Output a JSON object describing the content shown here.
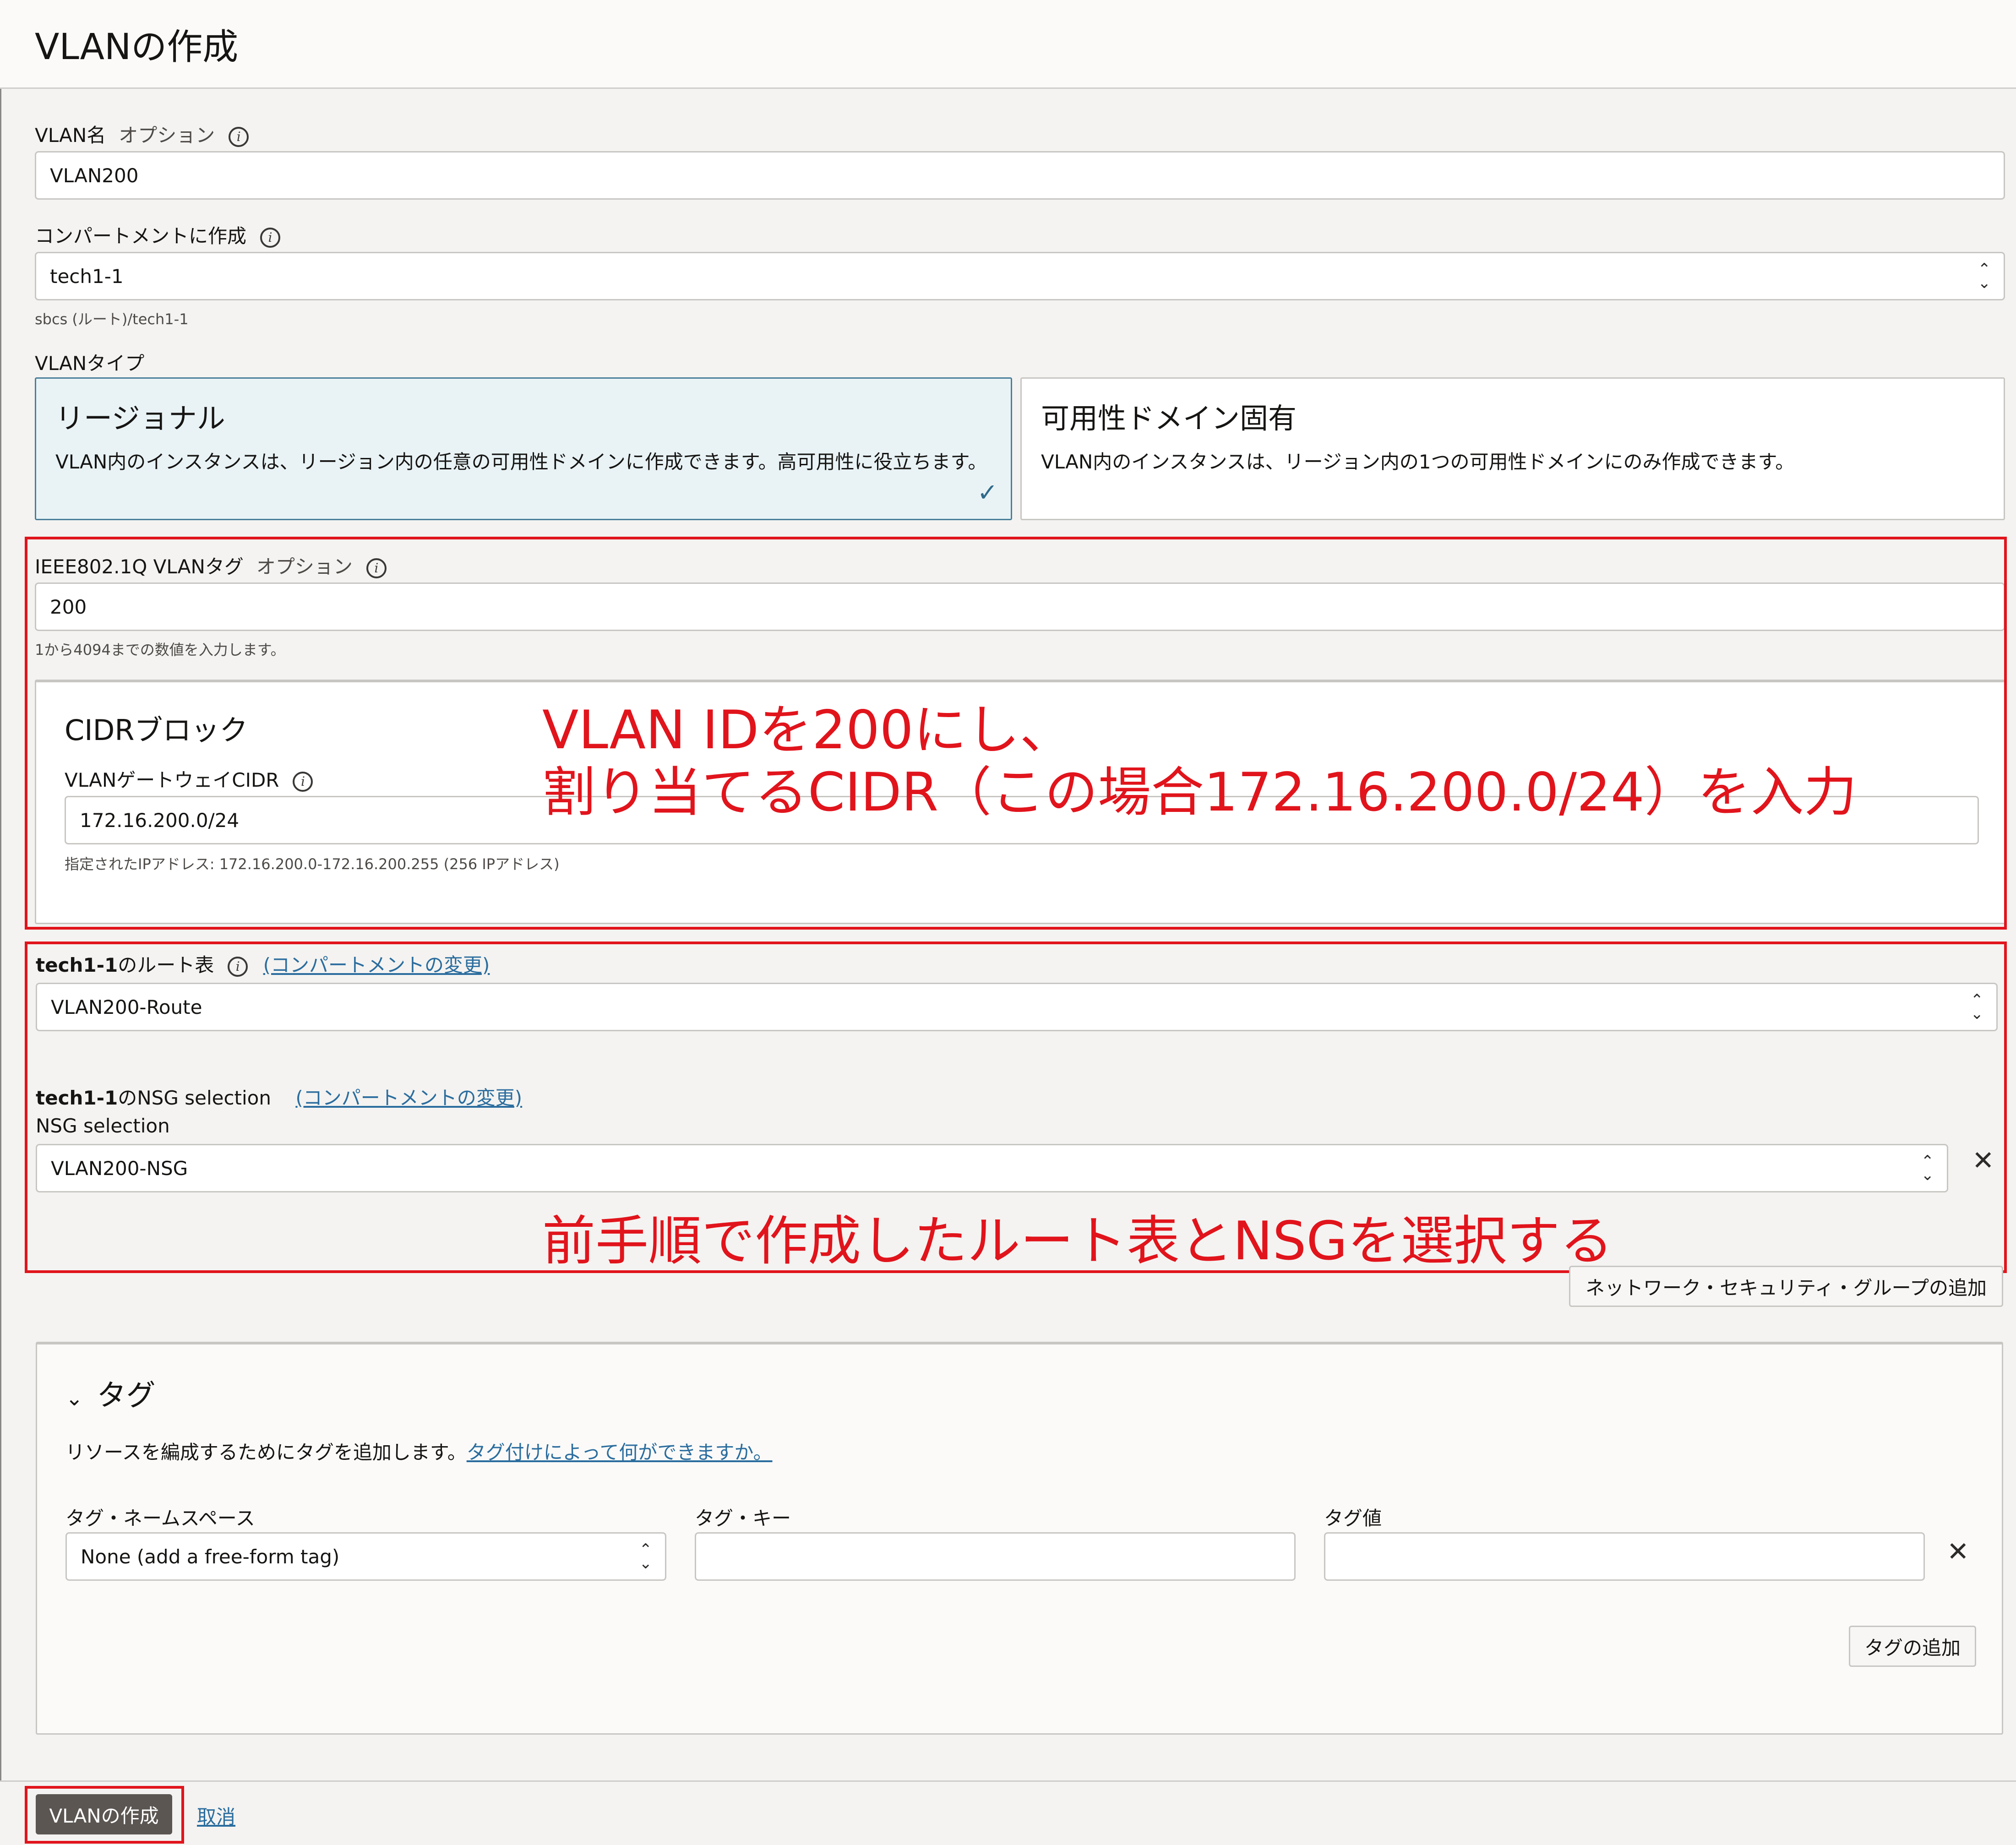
{
  "header": {
    "title": "VLANの作成"
  },
  "vlan_name": {
    "label": "VLAN名",
    "optional": "オプション",
    "value": "VLAN200"
  },
  "compartment": {
    "label": "コンパートメントに作成",
    "value": "tech1-1",
    "path": "sbcs (ルート)/tech1-1"
  },
  "vlan_type": {
    "label": "VLANタイプ",
    "options": [
      {
        "title": "リージョナル",
        "desc": "VLAN内のインスタンスは、リージョン内の任意の可用性ドメインに作成できます。高可用性に役立ちます。",
        "selected": true
      },
      {
        "title": "可用性ドメイン固有",
        "desc": "VLAN内のインスタンスは、リージョン内の1つの可用性ドメインにのみ作成できます。",
        "selected": false
      }
    ]
  },
  "vlan_tag": {
    "label": "IEEE802.1Q VLANタグ",
    "optional": "オプション",
    "value": "200",
    "hint": "1から4094までの数値を入力します。"
  },
  "cidr": {
    "heading": "CIDRブロック",
    "label": "VLANゲートウェイCIDR",
    "value": "172.16.200.0/24",
    "hint": "指定されたIPアドレス: 172.16.200.0-172.16.200.255 (256 IPアドレス)"
  },
  "annotations": {
    "line1": "VLAN IDを200にし、",
    "line2": "割り当てるCIDR（この場合172.16.200.0/24）を入力",
    "line3": "前手順で作成したルート表とNSGを選択する",
    "color": "#e1141c"
  },
  "route_table": {
    "label_bold": "tech1-1",
    "label_rest": "のルート表",
    "change_link": "(コンパートメントの変更)",
    "value": "VLAN200-Route"
  },
  "nsg": {
    "label_bold": "tech1-1",
    "label_rest": "のNSG selection",
    "change_link": "(コンパートメントの変更)",
    "field_label": "NSG selection",
    "value": "VLAN200-NSG",
    "add_button": "ネットワーク・セキュリティ・グループの追加"
  },
  "tags": {
    "heading": "タグ",
    "desc": "リソースを編成するためにタグを追加します。",
    "desc_link": "タグ付けによって何ができますか。",
    "namespace_label": "タグ・ネームスペース",
    "namespace_value": "None (add a free-form tag)",
    "key_label": "タグ・キー",
    "key_value": "",
    "value_label": "タグ値",
    "value_value": "",
    "add_button": "タグの追加"
  },
  "footer": {
    "create_button": "VLANの作成",
    "cancel_link": "取消"
  },
  "icons": {
    "info": "info-icon",
    "select": "updown-arrows-icon",
    "close": "close-icon",
    "check": "checkmark-icon",
    "chevron": "chevron-down-icon"
  },
  "colors": {
    "accent_link": "#2b6d9e",
    "primary_button": "#5b5652",
    "selected_card": "#e9f3f6"
  }
}
